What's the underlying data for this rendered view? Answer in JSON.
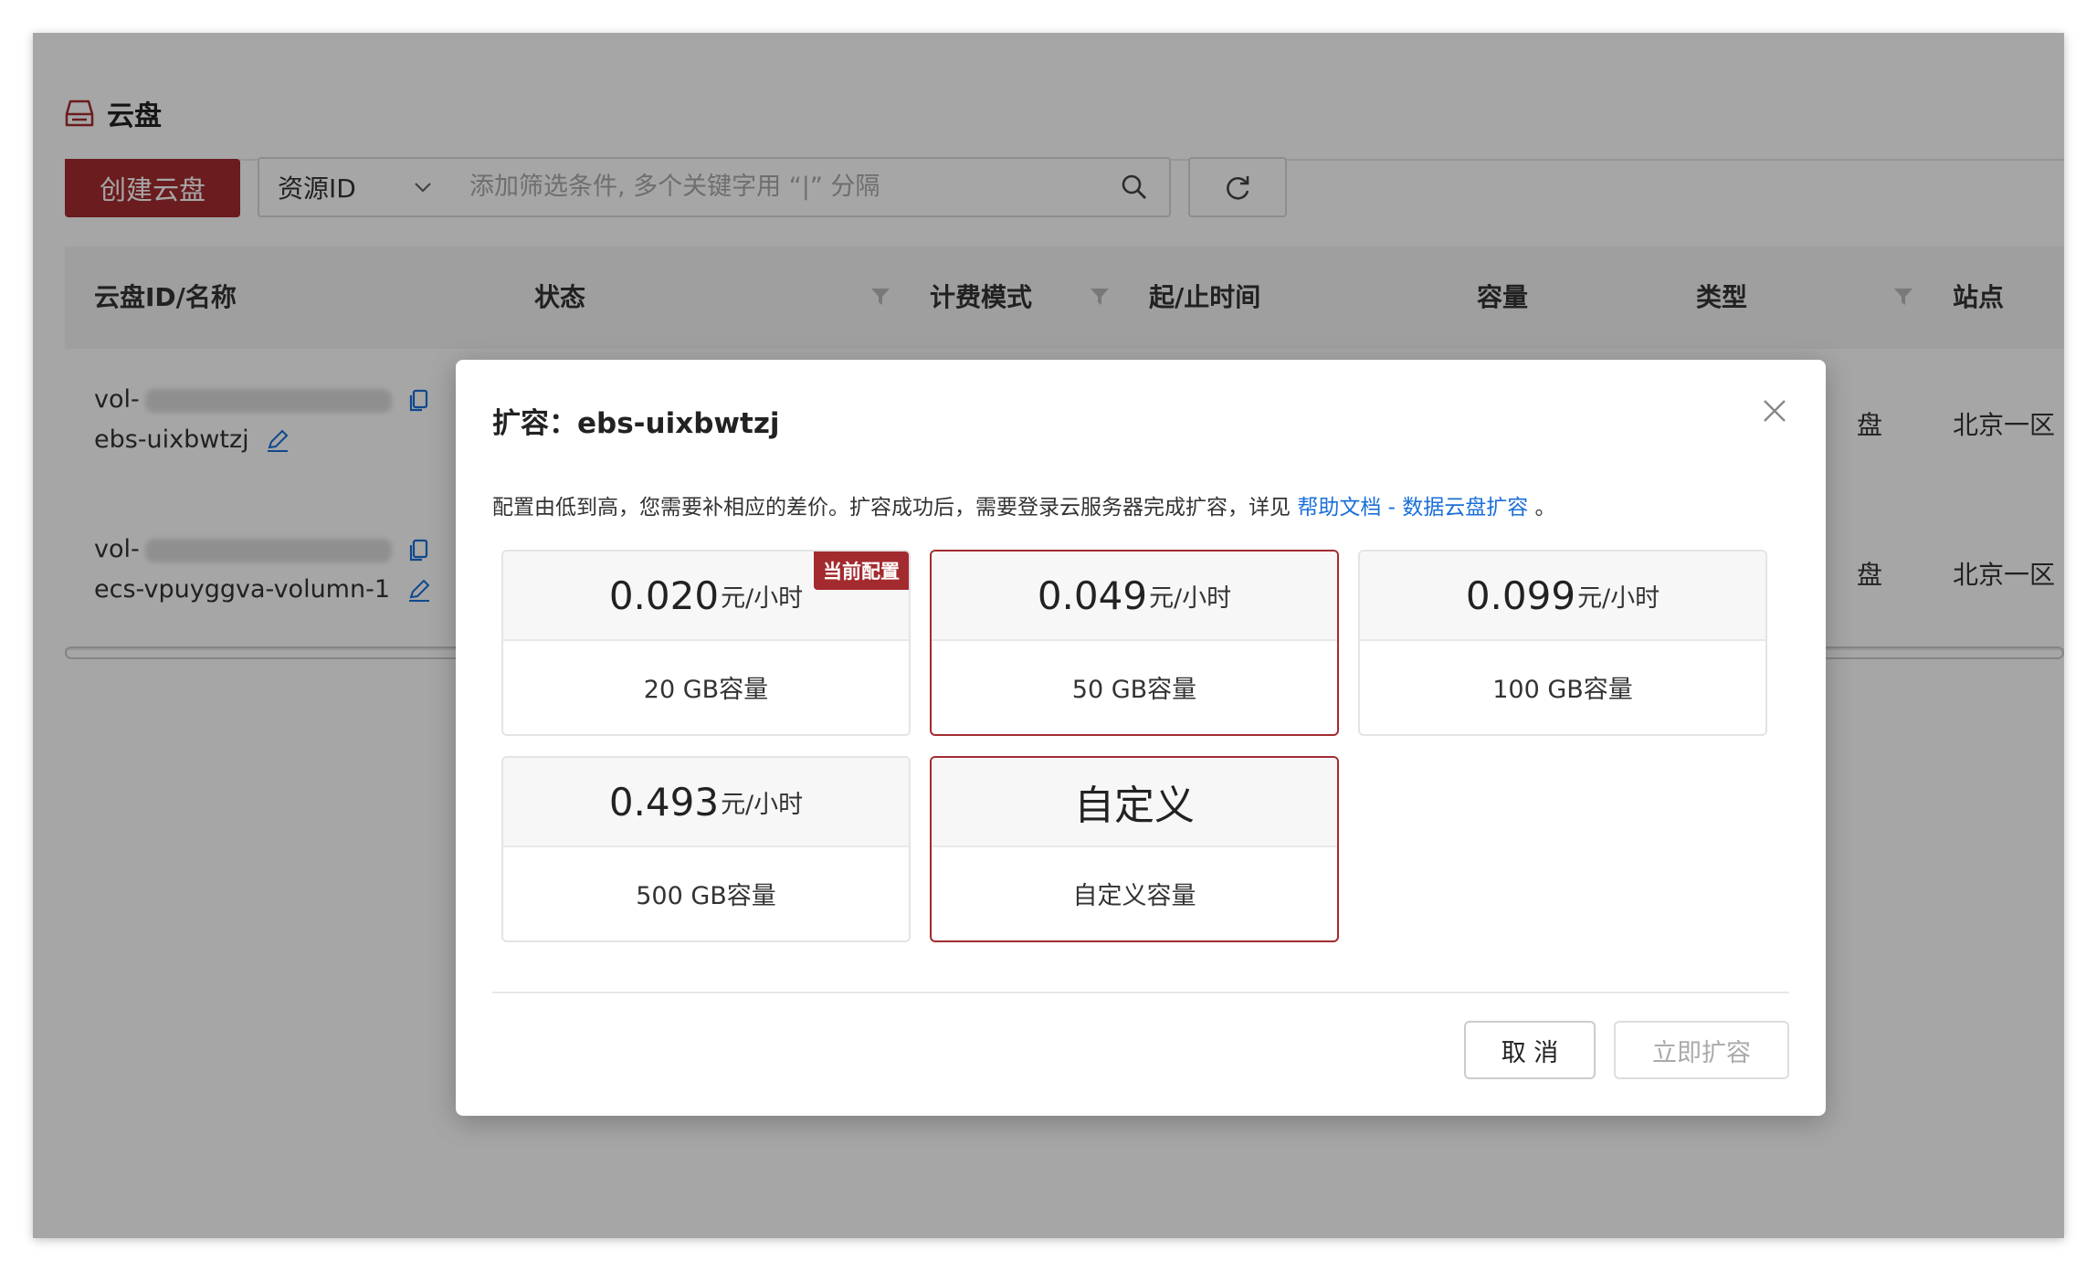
{
  "tab": {
    "label": "云盘"
  },
  "toolbar": {
    "create_label": "创建云盘",
    "filter_select": "资源ID",
    "search_placeholder": "添加筛选条件, 多个关键字用 “|” 分隔"
  },
  "table": {
    "columns": [
      "云盘ID/名称",
      "状态",
      "计费模式",
      "起/止时间",
      "容量",
      "类型",
      "站点"
    ],
    "rows": [
      {
        "id_prefix": "vol-",
        "name": "ebs-uixbwtzj",
        "type": "盘",
        "zone": "北京一区"
      },
      {
        "id_prefix": "vol-",
        "name": "ecs-vpuyggva-volumn-1",
        "type": "盘",
        "zone": "北京一区"
      }
    ]
  },
  "modal": {
    "title": "扩容：ebs-uixbwtzj",
    "desc_text": "配置由低到高，您需要补相应的差价。扩容成功后，需要登录云服务器完成扩容，详见",
    "desc_link": "帮助文档 - 数据云盘扩容",
    "desc_end": "。",
    "badge": "当前配置",
    "unit": "元/小时",
    "cards": [
      {
        "price": "0.020",
        "capacity": "20 GB容量"
      },
      {
        "price": "0.049",
        "capacity": "50 GB容量"
      },
      {
        "price": "0.099",
        "capacity": "100 GB容量"
      },
      {
        "price": "0.493",
        "capacity": "500 GB容量"
      }
    ],
    "custom": {
      "title": "自定义",
      "capacity": "自定义容量"
    },
    "cancel_label": "取 消",
    "confirm_label": "立即扩容"
  },
  "colors": {
    "brand": "#a32b2f",
    "link": "#1a6fd9"
  }
}
